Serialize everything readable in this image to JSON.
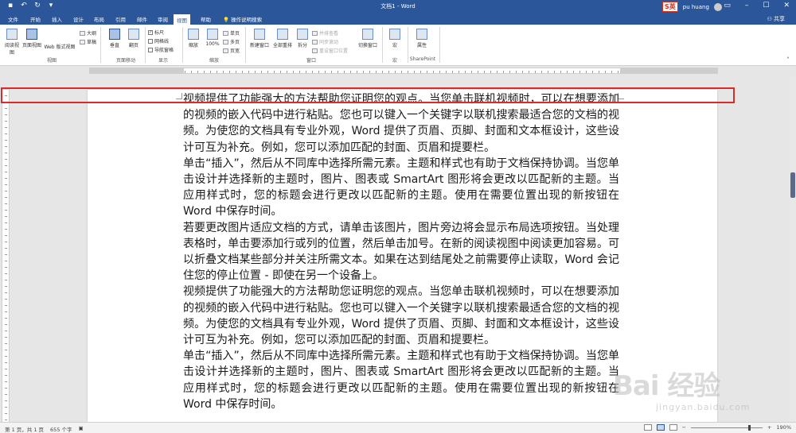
{
  "window": {
    "doc_title": "文档1 - Word",
    "user_name": "pu huang",
    "ime_badge": "S英",
    "share_label": "共享",
    "qat_icons": [
      "save-icon",
      "undo-icon",
      "redo-icon",
      "customize-icon"
    ]
  },
  "tabs": [
    {
      "label": "文件"
    },
    {
      "label": "开始"
    },
    {
      "label": "插入"
    },
    {
      "label": "设计"
    },
    {
      "label": "布局"
    },
    {
      "label": "引用"
    },
    {
      "label": "邮件"
    },
    {
      "label": "审阅"
    },
    {
      "label": "视图",
      "active": true
    },
    {
      "label": "帮助"
    },
    {
      "label": "操作说明搜索"
    }
  ],
  "ribbon": {
    "views": {
      "read_mode": "阅读视图",
      "print_layout": "页面视图",
      "web_layout": "Web 版式视图",
      "outline": "大纲",
      "draft": "草稿",
      "group": "视图"
    },
    "page_movement": {
      "vertical": "垂直",
      "side_to_side": "翻页",
      "group": "页面移动"
    },
    "show": {
      "ruler": "标尺",
      "gridlines": "网格线",
      "nav_pane": "导航窗格",
      "group": "显示",
      "ruler_checked": true
    },
    "zoom": {
      "zoom": "缩放",
      "hundred": "100%",
      "one_page": "单页",
      "multi_page": "多页",
      "page_width": "页宽",
      "group": "缩放"
    },
    "window": {
      "new_window": "新建窗口",
      "arrange_all": "全部重排",
      "split": "拆分",
      "side_by_side": "并排查看",
      "sync_scroll": "同步滚动",
      "reset_pos": "重设窗口位置",
      "switch": "切换窗口",
      "group": "窗口"
    },
    "macros": {
      "macros": "宏",
      "group": "宏"
    },
    "sharepoint": {
      "properties": "属性",
      "group": "SharePoint"
    }
  },
  "document": {
    "paragraphs": [
      "视频提供了功能强大的方法帮助您证明您的观点。当您单击联机视频时，可以在想要添加的视频的嵌入代码中进行粘贴。您也可以键入一个关键字以联机搜索最适合您的文档的视频。为使您的文档具有专业外观，Word 提供了页眉、页脚、封面和文本框设计，这些设计可互为补充。例如，您可以添加匹配的封面、页眉和提要栏。",
      "单击“插入”，然后从不同库中选择所需元素。主题和样式也有助于文档保持协调。当您单击设计并选择新的主题时，图片、图表或 SmartArt 图形将会更改以匹配新的主题。当应用样式时，您的标题会进行更改以匹配新的主题。使用在需要位置出现的新按钮在 Word 中保存时间。",
      "若要更改图片适应文档的方式，请单击该图片，图片旁边将会显示布局选项按钮。当处理表格时，单击要添加行或列的位置，然后单击加号。在新的阅读视图中阅读更加容易。可以折叠文档某些部分并关注所需文本。如果在达到结尾处之前需要停止读取，Word 会记住您的停止位置 - 即使在另一个设备上。",
      "视频提供了功能强大的方法帮助您证明您的观点。当您单击联机视频时，可以在想要添加的视频的嵌入代码中进行粘贴。您也可以键入一个关键字以联机搜索最适合您的文档的视频。为使您的文档具有专业外观，Word 提供了页眉、页脚、封面和文本框设计，这些设计可互为补充。例如，您可以添加匹配的封面、页眉和提要栏。",
      "单击“插入”，然后从不同库中选择所需元素。主题和样式也有助于文档保持协调。当您单击设计并选择新的主题时，图片、图表或 SmartArt 图形将会更改以匹配新的主题。当应用样式时，您的标题会进行更改以匹配新的主题。使用在需要位置出现的新按钮在 Word 中保存时间。"
    ]
  },
  "status": {
    "page": "第 1 页，共 1 页",
    "words": "655 个字",
    "zoom": "190%",
    "zoom_minus": "−",
    "zoom_plus": "+"
  },
  "watermark": {
    "brand": "Bai 经验",
    "url": "jingyan.baidu.com"
  },
  "colors": {
    "accent": "#2b579a",
    "highlight": "#d92b2b"
  }
}
